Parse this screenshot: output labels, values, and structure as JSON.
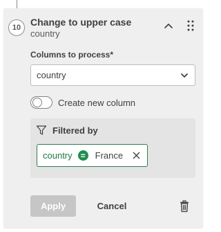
{
  "step": {
    "number": "10",
    "title": "Change to upper case",
    "subtitle": "country",
    "collapse_icon": "chevron-up-icon",
    "drag_icon": "drag-handle-icon"
  },
  "columns_field": {
    "label": "Columns to process*",
    "value": "country",
    "icon": "chevron-down-icon"
  },
  "create_new_column": {
    "label": "Create new column",
    "checked": false
  },
  "filter": {
    "title": "Filtered by",
    "icon": "filter-icon",
    "condition": {
      "field": "country",
      "operator": "=",
      "value": "France",
      "remove_icon": "close-icon"
    }
  },
  "actions": {
    "apply_label": "Apply",
    "apply_disabled": true,
    "cancel_label": "Cancel",
    "delete_icon": "trash-icon"
  },
  "colors": {
    "accent_green": "#1f8f4e",
    "card_background": "#efefef",
    "disabled_button": "#c6c6c6"
  }
}
